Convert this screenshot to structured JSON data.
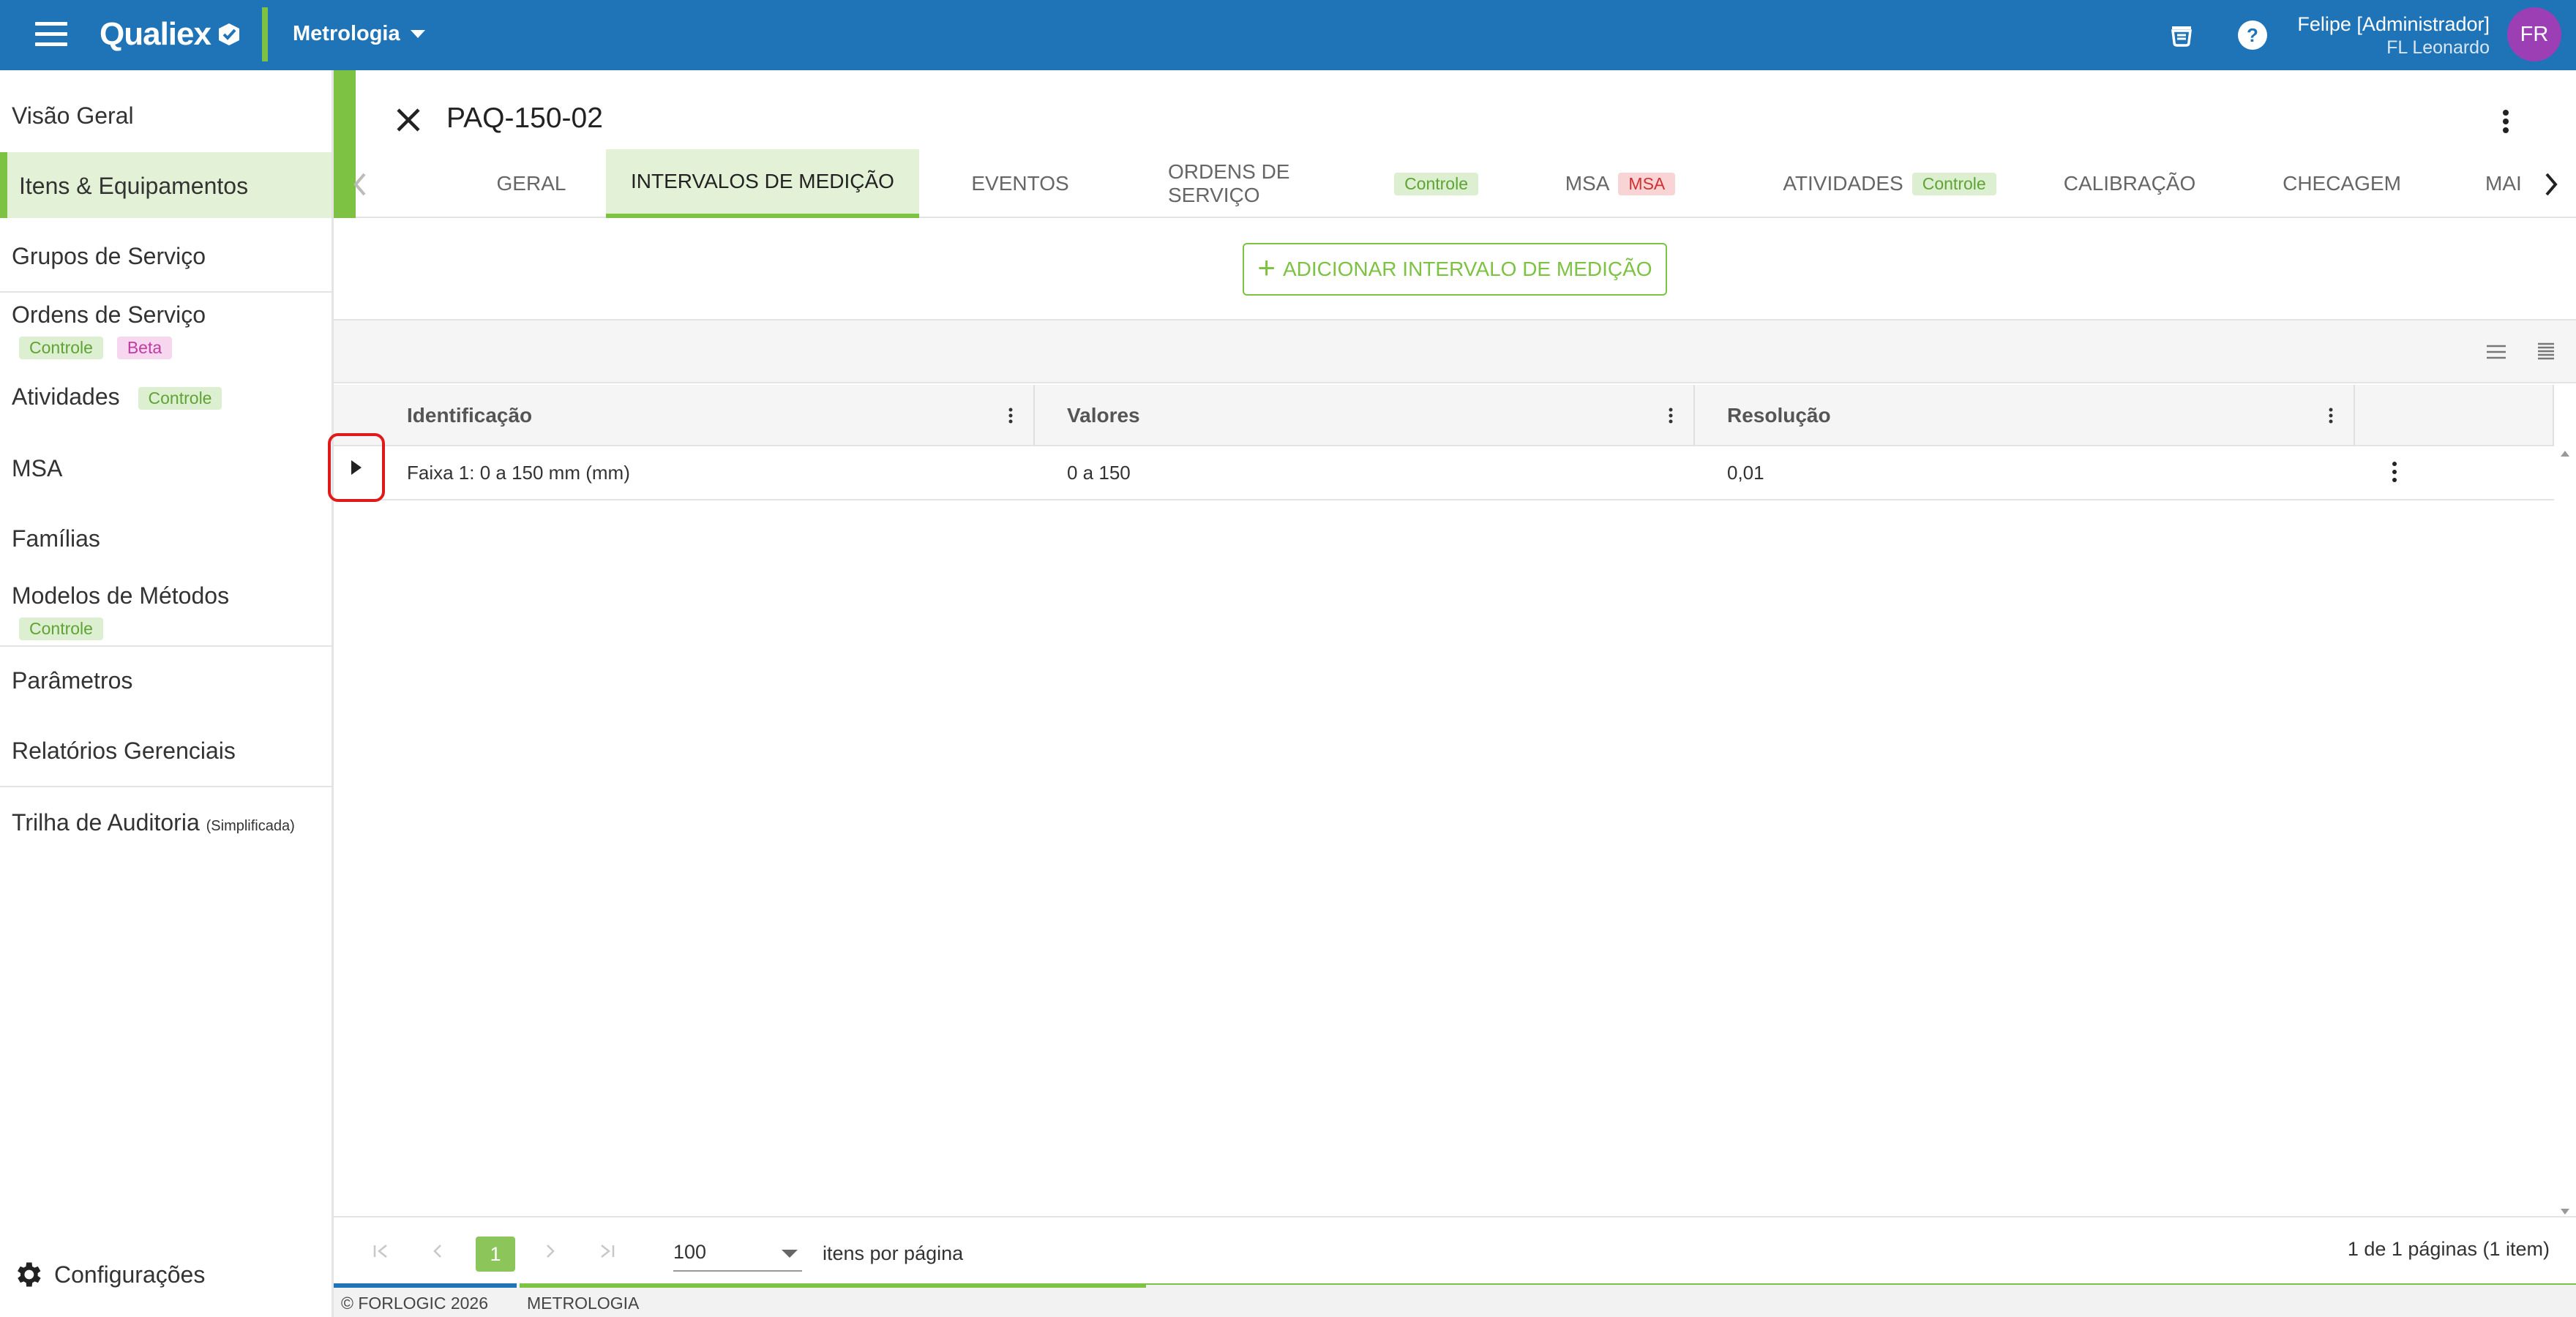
{
  "app": {
    "logo": "Qualiex",
    "module": "Metrologia",
    "user_name": "Felipe [Administrador]",
    "user_company": "FL Leonardo",
    "avatar_initials": "FR",
    "brand_blue": "#1f73b7",
    "brand_green": "#7dc242"
  },
  "sidebar": {
    "items": [
      {
        "label": "Visão Geral"
      },
      {
        "label": "Itens & Equipamentos"
      },
      {
        "label": "Grupos de Serviço"
      },
      {
        "label": "Ordens de Serviço",
        "badge1": "Controle",
        "badge2": "Beta"
      },
      {
        "label": "Atividades",
        "badge1": "Controle"
      },
      {
        "label": "MSA"
      },
      {
        "label": "Famílias"
      },
      {
        "label": "Modelos de Métodos",
        "badge1": "Controle"
      },
      {
        "label": "Parâmetros"
      },
      {
        "label": "Relatórios Gerenciais"
      },
      {
        "label": "Trilha de Auditoria",
        "note": "(Simplificada)"
      }
    ],
    "config_label": "Configurações"
  },
  "header": {
    "title": "PAQ-150-02"
  },
  "tabs": [
    {
      "label": "GERAL"
    },
    {
      "label": "INTERVALOS DE MEDIÇÃO"
    },
    {
      "label": "EVENTOS"
    },
    {
      "label": "ORDENS DE SERVIÇO",
      "badge": "Controle"
    },
    {
      "label": "MSA",
      "badge": "MSA"
    },
    {
      "label": "ATIVIDADES",
      "badge": "Controle"
    },
    {
      "label": "CALIBRAÇÃO"
    },
    {
      "label": "CHECAGEM"
    },
    {
      "label": "MAI"
    }
  ],
  "add_button_label": "ADICIONAR INTERVALO DE MEDIÇÃO",
  "grid": {
    "columns": [
      "Identificação",
      "Valores",
      "Resolução"
    ],
    "rows": [
      {
        "identificacao": "Faixa 1: 0 a 150 mm (mm)",
        "valores": "0 a 150",
        "resolucao": "0,01"
      }
    ]
  },
  "pager": {
    "current_page": "1",
    "page_size": "100",
    "page_size_label": "itens por página",
    "info": "1 de 1 páginas (1 item)"
  },
  "footer": {
    "copyright": "© FORLOGIC 2026",
    "module": "METROLOGIA"
  }
}
